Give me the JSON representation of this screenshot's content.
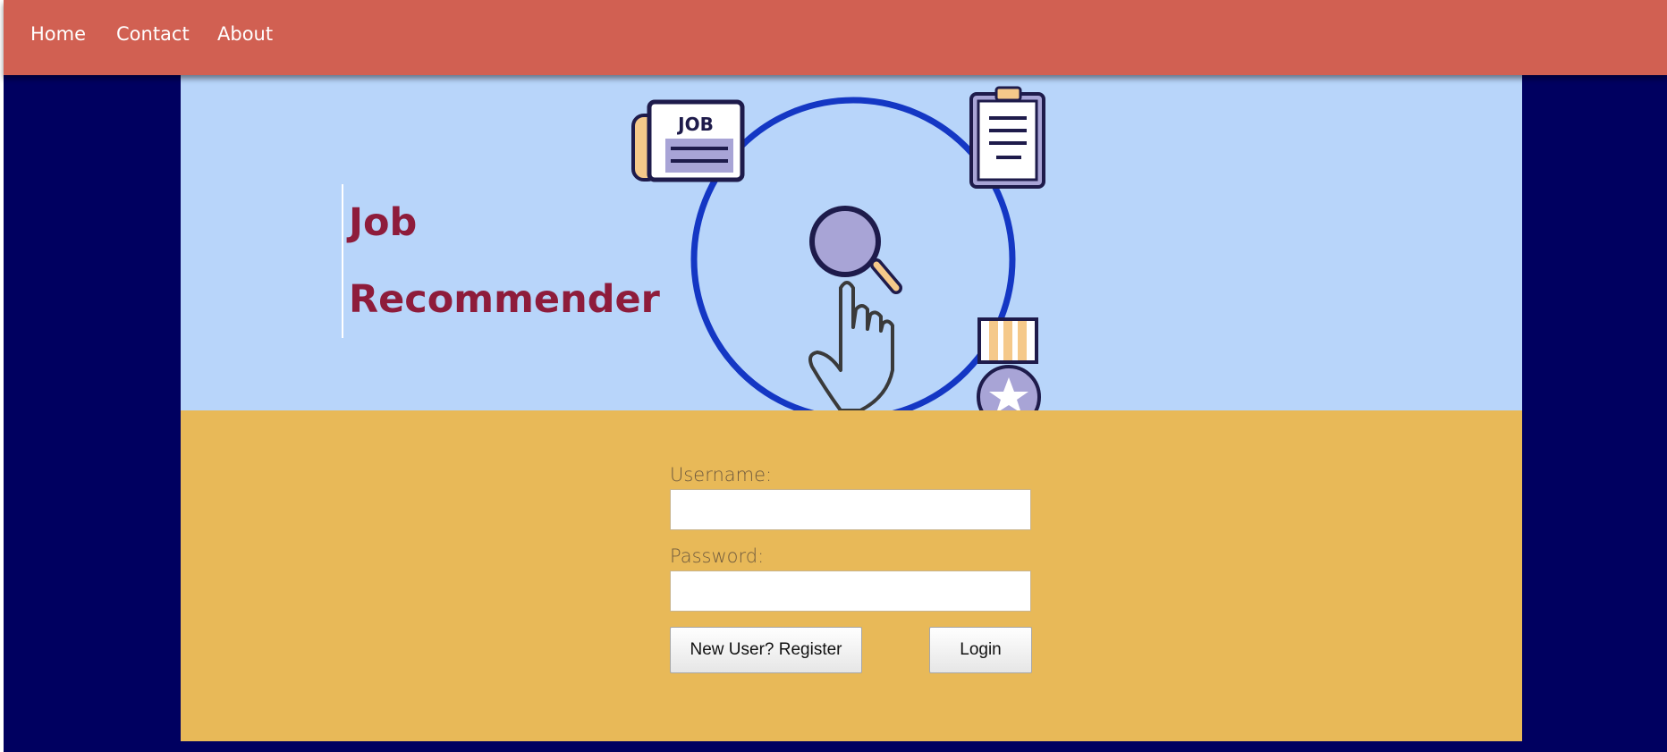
{
  "nav": {
    "items": [
      {
        "label": "Home"
      },
      {
        "label": "Contact"
      },
      {
        "label": "About"
      }
    ]
  },
  "hero": {
    "title_line1": "Job",
    "title_line2": "Recommender",
    "newspaper_text": "JOB"
  },
  "login": {
    "username_label": "Username:",
    "username_value": "",
    "password_label": "Password:",
    "password_value": "",
    "register_button": "New User? Register",
    "login_button": "Login"
  },
  "colors": {
    "navbar": "#d16052",
    "page_background": "#000060",
    "hero_background": "#b8d5fa",
    "form_background": "#e8b958",
    "title_color": "#8e1c3b"
  }
}
